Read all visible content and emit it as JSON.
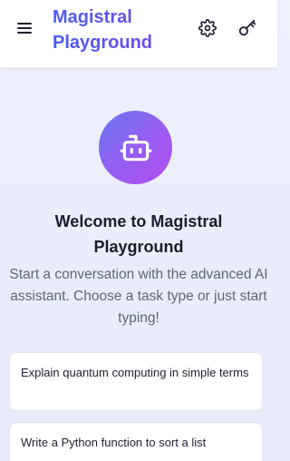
{
  "header": {
    "title": "Magistral Playground",
    "menu_icon": "hamburger-menu-icon",
    "settings_icon": "gear-icon",
    "key_icon": "key-icon"
  },
  "welcome": {
    "avatar_icon": "robot-icon",
    "title": "Welcome to Magistral Playground",
    "subtitle": "Start a conversation with the advanced AI assistant. Choose a task type or just start typing!"
  },
  "suggestions": [
    {
      "text": "Explain quantum computing in simple terms"
    },
    {
      "text": "Write a Python function to sort a list"
    }
  ],
  "colors": {
    "brand_gradient_start": "#4a5df0",
    "brand_gradient_end": "#7b45e6",
    "avatar_gradient_start": "#6678f3",
    "avatar_gradient_end": "#b04ff0"
  }
}
